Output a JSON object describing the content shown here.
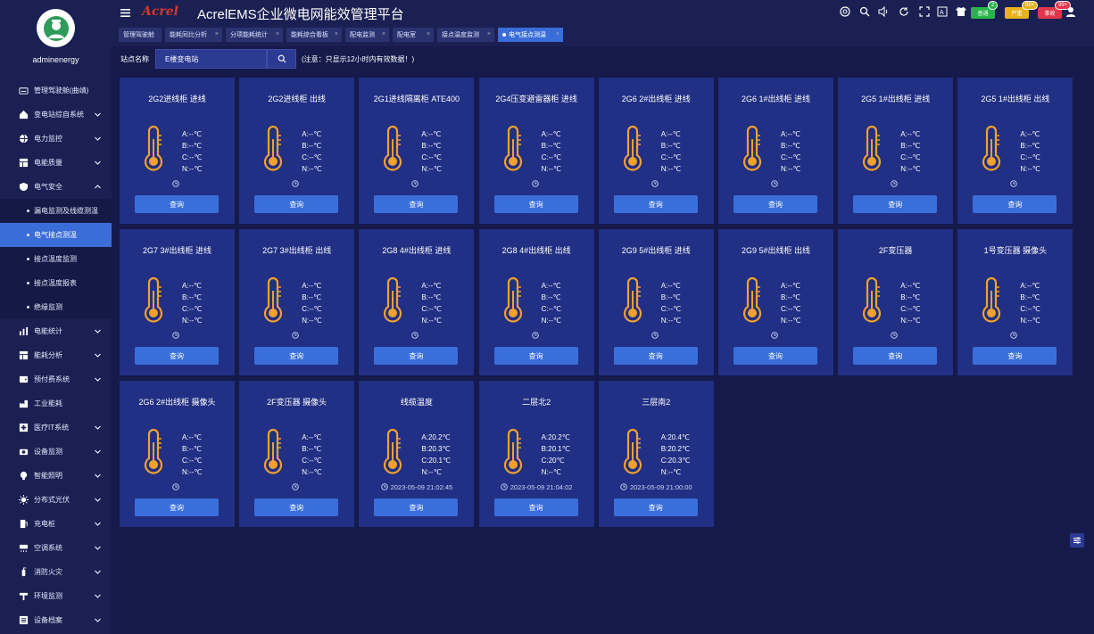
{
  "user": {
    "name": "adminenergy"
  },
  "header": {
    "logo": "Acrel",
    "title": "AcrelEMS企业微电网能效管理平台",
    "badges": [
      {
        "label": "普通",
        "count": "2",
        "color": "#28b54a"
      },
      {
        "label": "严重",
        "count": "99+",
        "color": "#e8b21c"
      },
      {
        "label": "事故",
        "count": "99+",
        "color": "#e0364b"
      }
    ],
    "icons": [
      "monitor-icon",
      "search-icon",
      "volume-icon",
      "refresh-icon",
      "fullscreen-icon",
      "translate-icon",
      "shirt-icon"
    ]
  },
  "menu": [
    {
      "label": "管理驾驶舱(曲靖)",
      "icon": "dashboard-icon",
      "chevron": false
    },
    {
      "label": "变电站综自系统",
      "icon": "home-icon",
      "chevron": true
    },
    {
      "label": "电力监控",
      "icon": "globe-icon",
      "chevron": true
    },
    {
      "label": "电能质量",
      "icon": "grid-icon",
      "chevron": true
    },
    {
      "label": "电气安全",
      "icon": "shield-icon",
      "chevron": "up"
    },
    {
      "label": "漏电监测及线缆测温",
      "sub": true
    },
    {
      "label": "电气接点测温",
      "sub": true,
      "active": true
    },
    {
      "label": "接点温度监测",
      "sub": true
    },
    {
      "label": "接点温度报表",
      "sub": true
    },
    {
      "label": "绝缘监测",
      "sub": true
    },
    {
      "label": "电能统计",
      "icon": "bar-chart-icon",
      "chevron": true
    },
    {
      "label": "能耗分析",
      "icon": "grid-icon",
      "chevron": true
    },
    {
      "label": "预付费系统",
      "icon": "wallet-icon",
      "chevron": true
    },
    {
      "label": "工业能耗",
      "icon": "factory-icon",
      "chevron": false
    },
    {
      "label": "医疗IT系统",
      "icon": "hospital-icon",
      "chevron": true
    },
    {
      "label": "设备监测",
      "icon": "camera-icon",
      "chevron": true
    },
    {
      "label": "智能照明",
      "icon": "bulb-icon",
      "chevron": true
    },
    {
      "label": "分布式光伏",
      "icon": "sun-icon",
      "chevron": true
    },
    {
      "label": "充电桩",
      "icon": "charger-icon",
      "chevron": true
    },
    {
      "label": "空调系统",
      "icon": "ac-icon",
      "chevron": true
    },
    {
      "label": "消防火灾",
      "icon": "extinguisher-icon",
      "chevron": true
    },
    {
      "label": "环境监测",
      "icon": "sensor-icon",
      "chevron": true
    },
    {
      "label": "设备档案",
      "icon": "archive-icon",
      "chevron": true
    }
  ],
  "tabs": [
    {
      "label": "管理驾驶舱",
      "close": false
    },
    {
      "label": "能耗同比分析",
      "close": true
    },
    {
      "label": "分项能耗统计",
      "close": true
    },
    {
      "label": "能耗综合看板",
      "close": true
    },
    {
      "label": "配电监测",
      "close": true
    },
    {
      "label": "配电室",
      "close": true
    },
    {
      "label": "接点温度监测",
      "close": true
    },
    {
      "label": "电气接点测温",
      "close": true,
      "active": true
    }
  ],
  "search": {
    "label": "站点名称",
    "value": "E楼变电站",
    "note": "(注意：只显示12小时内有效数据！)"
  },
  "query_label": "查询",
  "cards": [
    {
      "title": "2G2进线柜 进线",
      "a": "A:--℃",
      "b": "B:--℃",
      "c": "C:--℃",
      "n": "N:--℃",
      "time": ""
    },
    {
      "title": "2G2进线柜 出线",
      "a": "A:--℃",
      "b": "B:--℃",
      "c": "C:--℃",
      "n": "N:--℃",
      "time": ""
    },
    {
      "title": "2G1进线隔离柜 ATE400",
      "a": "A:--℃",
      "b": "B:--℃",
      "c": "C:--℃",
      "n": "N:--℃",
      "time": ""
    },
    {
      "title": "2G4压变避雷器柜 进线",
      "a": "A:--℃",
      "b": "B:--℃",
      "c": "C:--℃",
      "n": "N:--℃",
      "time": ""
    },
    {
      "title": "2G6 2#出线柜 进线",
      "a": "A:--℃",
      "b": "B:--℃",
      "c": "C:--℃",
      "n": "N:--℃",
      "time": ""
    },
    {
      "title": "2G6 1#出线柜 进线",
      "a": "A:--℃",
      "b": "B:--℃",
      "c": "C:--℃",
      "n": "N:--℃",
      "time": ""
    },
    {
      "title": "2G5 1#出线柜 进线",
      "a": "A:--℃",
      "b": "B:--℃",
      "c": "C:--℃",
      "n": "N:--℃",
      "time": ""
    },
    {
      "title": "2G5 1#出线柜 出线",
      "a": "A:--℃",
      "b": "B:--℃",
      "c": "C:--℃",
      "n": "N:--℃",
      "time": ""
    },
    {
      "title": "2G7 3#出线柜 进线",
      "a": "A:--℃",
      "b": "B:--℃",
      "c": "C:--℃",
      "n": "N:--℃",
      "time": ""
    },
    {
      "title": "2G7 3#出线柜 出线",
      "a": "A:--℃",
      "b": "B:--℃",
      "c": "C:--℃",
      "n": "N:--℃",
      "time": ""
    },
    {
      "title": "2G8 4#出线柜 进线",
      "a": "A:--℃",
      "b": "B:--℃",
      "c": "C:--℃",
      "n": "N:--℃",
      "time": ""
    },
    {
      "title": "2G8 4#出线柜 出线",
      "a": "A:--℃",
      "b": "B:--℃",
      "c": "C:--℃",
      "n": "N:--℃",
      "time": ""
    },
    {
      "title": "2G9 5#出线柜 进线",
      "a": "A:--℃",
      "b": "B:--℃",
      "c": "C:--℃",
      "n": "N:--℃",
      "time": ""
    },
    {
      "title": "2G9 5#出线柜 出线",
      "a": "A:--℃",
      "b": "B:--℃",
      "c": "C:--℃",
      "n": "N:--℃",
      "time": ""
    },
    {
      "title": "2F变压器",
      "a": "A:--℃",
      "b": "B:--℃",
      "c": "C:--℃",
      "n": "N:--℃",
      "time": ""
    },
    {
      "title": "1号变压器 摄像头",
      "a": "A:--℃",
      "b": "B:--℃",
      "c": "C:--℃",
      "n": "N:--℃",
      "time": ""
    },
    {
      "title": "2G6 2#出线柜 摄像头",
      "a": "A:--℃",
      "b": "B:--℃",
      "c": "C:--℃",
      "n": "N:--℃",
      "time": ""
    },
    {
      "title": "2F变压器 摄像头",
      "a": "A:--℃",
      "b": "B:--℃",
      "c": "C:--℃",
      "n": "N:--℃",
      "time": ""
    },
    {
      "title": "线缆温度",
      "a": "A:20.2℃",
      "b": "B:20.3℃",
      "c": "C:20.1℃",
      "n": "N:--℃",
      "time": "2023-05-09 21:02:45"
    },
    {
      "title": "二层北2",
      "a": "A:20.2℃",
      "b": "B:20.1℃",
      "c": "C:20℃",
      "n": "N:--℃",
      "time": "2023-05-09 21:04:02"
    },
    {
      "title": "三层南2",
      "a": "A:20.4℃",
      "b": "B:20.2℃",
      "c": "C:20.3℃",
      "n": "N:--℃",
      "time": "2023-05-09 21:00:00"
    }
  ]
}
